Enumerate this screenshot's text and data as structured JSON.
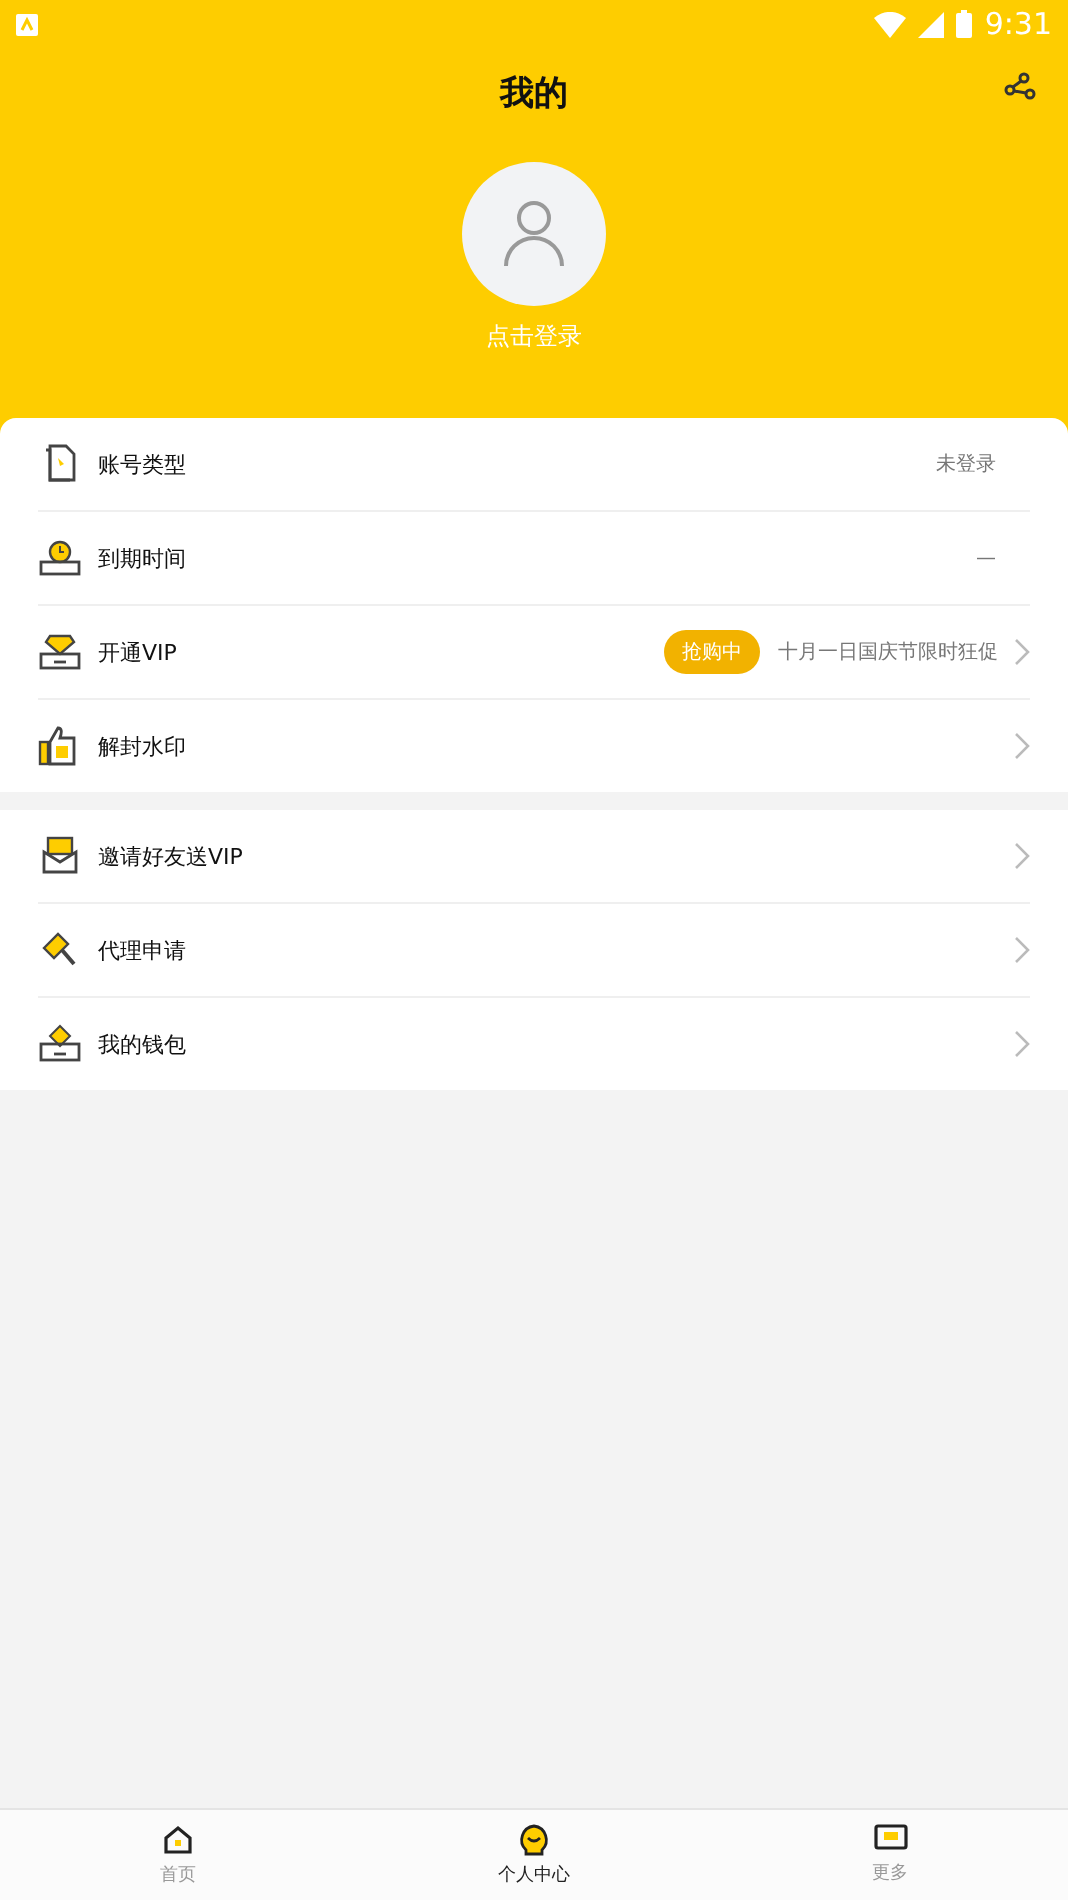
{
  "status_bar": {
    "time": "9:31"
  },
  "header": {
    "title": "我的"
  },
  "profile": {
    "login": "点击登录"
  },
  "groups": [
    {
      "rows": [
        {
          "label": "账号类型",
          "kind": "value",
          "value": "未登录"
        },
        {
          "label": "到期时间",
          "kind": "value",
          "value": "—"
        },
        {
          "label": "开通VIP",
          "kind": "promo",
          "badge": "抢购中",
          "value": "十月一日国庆节限时狂促"
        },
        {
          "label": "解封水印",
          "kind": "link"
        }
      ]
    },
    {
      "rows": [
        {
          "label": "邀请好友送VIP",
          "kind": "link"
        },
        {
          "label": "代理申请",
          "kind": "link"
        },
        {
          "label": "我的钱包",
          "kind": "link"
        }
      ]
    }
  ],
  "tabs": [
    {
      "label": "首页",
      "selected": false
    },
    {
      "label": "个人中心",
      "selected": true
    },
    {
      "label": "更多",
      "selected": false
    }
  ]
}
